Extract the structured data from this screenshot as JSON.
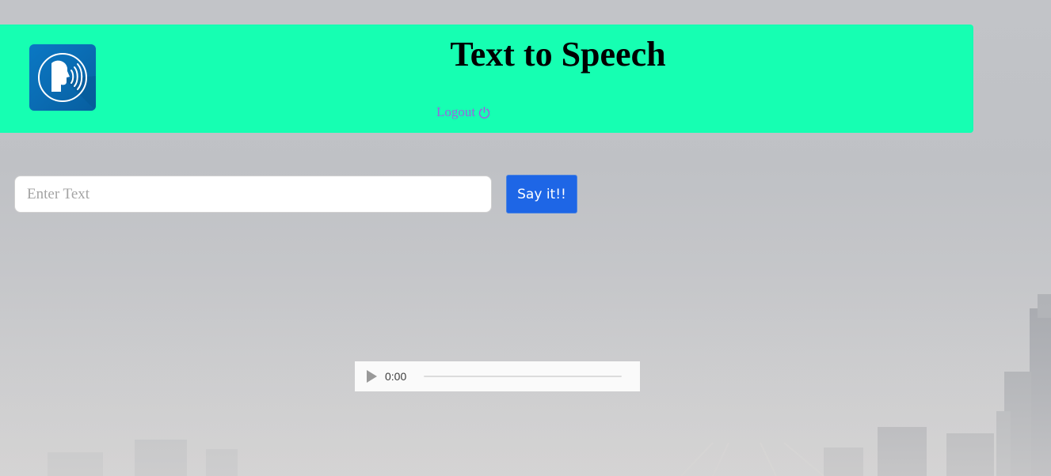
{
  "header": {
    "title": "Text to Speech",
    "logout_label": "Logout",
    "logo_icon": "speaking-head-icon",
    "logout_icon": "power-icon",
    "background_color": "#16ffb2"
  },
  "form": {
    "input_placeholder": "Enter Text",
    "input_value": "",
    "submit_label": "Say it!!",
    "button_color": "#1e66e6"
  },
  "audio": {
    "time": "0:00",
    "play_icon": "play-icon",
    "progress": 0
  },
  "colors": {
    "logout_text": "#9a63e0",
    "logo_bg": "#0a6cb3"
  }
}
